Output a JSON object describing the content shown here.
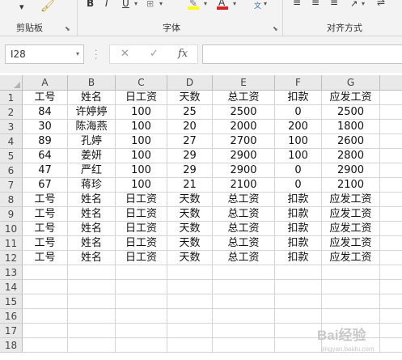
{
  "ribbon": {
    "groups": [
      "剪贴板",
      "字体",
      "对齐方式"
    ],
    "bold": "B",
    "italic": "I",
    "underline": "U",
    "font_color_glyph": "A",
    "phonetic_glyph": "文"
  },
  "formula_bar": {
    "name_box": "I28",
    "cancel": "✕",
    "enter": "✓",
    "fx": "fx",
    "formula": ""
  },
  "sheet": {
    "columns": [
      "A",
      "B",
      "C",
      "D",
      "E",
      "F",
      "G"
    ],
    "rows": [
      {
        "num": "1",
        "cells": [
          "工号",
          "姓名",
          "日工资",
          "天数",
          "总工资",
          "扣款",
          "应发工资"
        ]
      },
      {
        "num": "2",
        "cells": [
          "84",
          "许婷婷",
          "100",
          "25",
          "2500",
          "0",
          "2500"
        ]
      },
      {
        "num": "3",
        "cells": [
          "30",
          "陈海燕",
          "100",
          "20",
          "2000",
          "200",
          "1800"
        ]
      },
      {
        "num": "4",
        "cells": [
          "89",
          "孔婷",
          "100",
          "27",
          "2700",
          "100",
          "2600"
        ]
      },
      {
        "num": "5",
        "cells": [
          "64",
          "姜妍",
          "100",
          "29",
          "2900",
          "100",
          "2800"
        ]
      },
      {
        "num": "6",
        "cells": [
          "47",
          "严红",
          "100",
          "29",
          "2900",
          "0",
          "2900"
        ]
      },
      {
        "num": "7",
        "cells": [
          "67",
          "蒋珍",
          "100",
          "21",
          "2100",
          "0",
          "2100"
        ]
      },
      {
        "num": "8",
        "cells": [
          "工号",
          "姓名",
          "日工资",
          "天数",
          "总工资",
          "扣款",
          "应发工资"
        ]
      },
      {
        "num": "9",
        "cells": [
          "工号",
          "姓名",
          "日工资",
          "天数",
          "总工资",
          "扣款",
          "应发工资"
        ]
      },
      {
        "num": "10",
        "cells": [
          "工号",
          "姓名",
          "日工资",
          "天数",
          "总工资",
          "扣款",
          "应发工资"
        ]
      },
      {
        "num": "11",
        "cells": [
          "工号",
          "姓名",
          "日工资",
          "天数",
          "总工资",
          "扣款",
          "应发工资"
        ]
      },
      {
        "num": "12",
        "cells": [
          "工号",
          "姓名",
          "日工资",
          "天数",
          "总工资",
          "扣款",
          "应发工资"
        ]
      },
      {
        "num": "13",
        "cells": [
          "",
          "",
          "",
          "",
          "",
          "",
          ""
        ]
      },
      {
        "num": "14",
        "cells": [
          "",
          "",
          "",
          "",
          "",
          "",
          ""
        ]
      },
      {
        "num": "15",
        "cells": [
          "",
          "",
          "",
          "",
          "",
          "",
          ""
        ]
      },
      {
        "num": "16",
        "cells": [
          "",
          "",
          "",
          "",
          "",
          "",
          ""
        ]
      },
      {
        "num": "17",
        "cells": [
          "",
          "",
          "",
          "",
          "",
          "",
          ""
        ]
      },
      {
        "num": "18",
        "cells": [
          "",
          "",
          "",
          "",
          "",
          "",
          ""
        ]
      }
    ]
  },
  "watermark": {
    "text": "Bai经验",
    "sub": "jingyan.baidu.com"
  },
  "colors": {
    "highlight_bar": "#ffff00",
    "font_color_bar": "#e02020",
    "header_bg": "#e9e9e9",
    "grid": "#d4d4d4"
  }
}
